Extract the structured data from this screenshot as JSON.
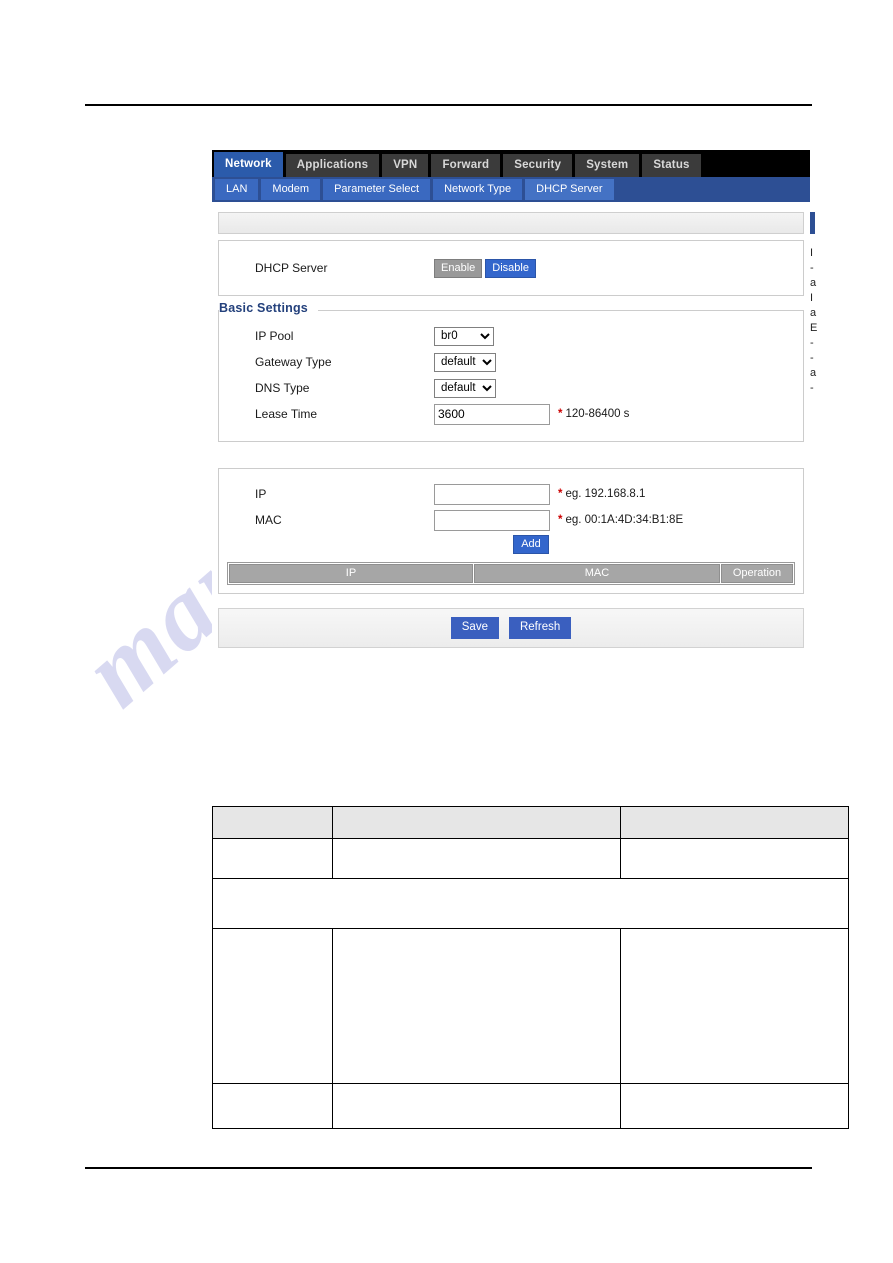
{
  "page": {
    "watermark": "manualshive.com"
  },
  "router_ui": {
    "primary_tabs": [
      {
        "label": "Network",
        "active": true
      },
      {
        "label": "Applications",
        "active": false
      },
      {
        "label": "VPN",
        "active": false
      },
      {
        "label": "Forward",
        "active": false
      },
      {
        "label": "Security",
        "active": false
      },
      {
        "label": "System",
        "active": false
      },
      {
        "label": "Status",
        "active": false
      }
    ],
    "secondary_tabs": [
      {
        "label": "LAN",
        "active": false
      },
      {
        "label": "Modem",
        "active": false
      },
      {
        "label": "Parameter Select",
        "active": false
      },
      {
        "label": "Network Type",
        "active": false
      },
      {
        "label": "DHCP Server",
        "active": true
      }
    ],
    "dhcp_toggle": {
      "label": "DHCP Server",
      "enable_label": "Enable",
      "disable_label": "Disable",
      "enable_color": "#999999",
      "disable_color": "#3366cc"
    },
    "basic_settings": {
      "legend": "Basic Settings",
      "ip_pool": {
        "label": "IP Pool",
        "value": "br0",
        "options": [
          "br0"
        ]
      },
      "gateway_type": {
        "label": "Gateway Type",
        "value": "default",
        "options": [
          "default"
        ]
      },
      "dns_type": {
        "label": "DNS Type",
        "value": "default",
        "options": [
          "default"
        ]
      },
      "lease_time": {
        "label": "Lease Time",
        "value": "3600",
        "required_marker": "*",
        "hint": "120-86400 s"
      }
    },
    "binding": {
      "ip": {
        "label": "IP",
        "value": "",
        "required_marker": "*",
        "hint": "eg. 192.168.8.1"
      },
      "mac": {
        "label": "MAC",
        "value": "",
        "required_marker": "*",
        "hint": "eg. 00:1A:4D:34:B1:8E"
      },
      "add_label": "Add",
      "grid_headers": [
        "IP",
        "MAC",
        "Operation"
      ],
      "rows": []
    },
    "actions": {
      "save_label": "Save",
      "refresh_label": "Refresh"
    },
    "right_fragments": [
      "I",
      "-",
      "a",
      "I",
      "a",
      "",
      "E",
      "-",
      "",
      "-",
      "a",
      "-"
    ]
  },
  "doc_table": {
    "rows": [
      {
        "cells": [
          "",
          "",
          ""
        ],
        "head": true,
        "height": 32
      },
      {
        "cells": [
          "",
          "",
          ""
        ],
        "head": false,
        "height": 40
      },
      {
        "cells": [
          "",
          "",
          ""
        ],
        "head": false,
        "height": 50,
        "span": true
      },
      {
        "cells": [
          "",
          "",
          ""
        ],
        "head": false,
        "height": 155
      },
      {
        "cells": [
          "",
          "",
          ""
        ],
        "head": false,
        "height": 45
      }
    ]
  }
}
